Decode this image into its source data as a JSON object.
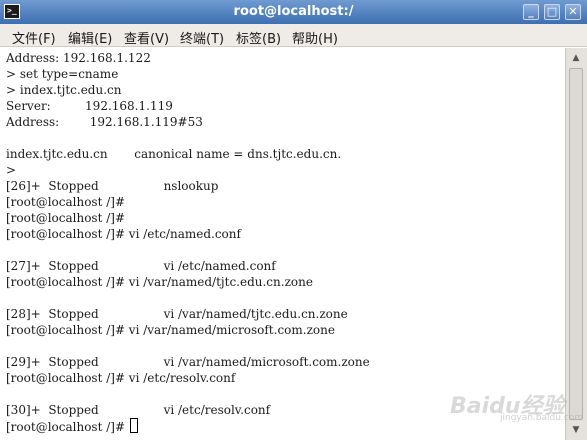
{
  "window": {
    "title": "root@localhost:/",
    "icon_text": ">_",
    "min": "_",
    "max": "□",
    "close": "✕"
  },
  "menu": [
    {
      "label": "文件(F)"
    },
    {
      "label": "编辑(E)"
    },
    {
      "label": "查看(V)"
    },
    {
      "label": "终端(T)"
    },
    {
      "label": "标签(B)"
    },
    {
      "label": "帮助(H)"
    }
  ],
  "terminal": {
    "lines": [
      "Address: 192.168.1.122",
      "> set type=cname",
      "> index.tjtc.edu.cn",
      "Server:         192.168.1.119",
      "Address:        192.168.1.119#53",
      "",
      "index.tjtc.edu.cn       canonical name = dns.tjtc.edu.cn.",
      ">",
      "[26]+  Stopped                 nslookup",
      "[root@localhost /]#",
      "[root@localhost /]#",
      "[root@localhost /]# vi /etc/named.conf",
      "",
      "[27]+  Stopped                 vi /etc/named.conf",
      "[root@localhost /]# vi /var/named/tjtc.edu.cn.zone",
      "",
      "[28]+  Stopped                 vi /var/named/tjtc.edu.cn.zone",
      "[root@localhost /]# vi /var/named/microsoft.com.zone",
      "",
      "[29]+  Stopped                 vi /var/named/microsoft.com.zone",
      "[root@localhost /]# vi /etc/resolv.conf",
      "",
      "[30]+  Stopped                 vi /etc/resolv.conf",
      "[root@localhost /]# "
    ]
  },
  "scrollbar": {
    "up": "▲",
    "down": "▼"
  },
  "watermark": {
    "text": "Baidu经验",
    "sub": "jingyan.baidu.com"
  }
}
